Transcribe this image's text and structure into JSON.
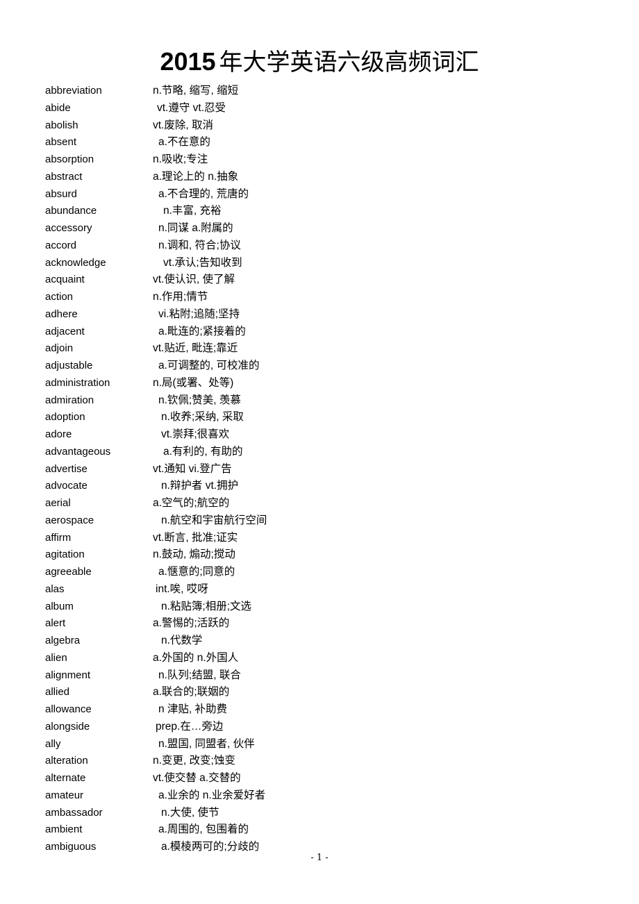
{
  "document": {
    "title_year": "2015",
    "title_rest": "年大学英语六级高频词汇",
    "page_footer": "- 1 -"
  },
  "word_list": {
    "entries": [
      {
        "term": "abbreviation",
        "definition": "n.节略, 缩写, 缩短",
        "indent": 0
      },
      {
        "term": "abide",
        "definition": "vt.遵守 vt.忍受",
        "indent": 6
      },
      {
        "term": "abolish",
        "definition": "vt.废除, 取消",
        "indent": 0
      },
      {
        "term": "absent",
        "definition": "a.不在意的",
        "indent": 8
      },
      {
        "term": "absorption",
        "definition": "n.吸收;专注",
        "indent": 0
      },
      {
        "term": "abstract",
        "definition": "a.理论上的 n.抽象",
        "indent": 0
      },
      {
        "term": "absurd",
        "definition": "a.不合理的, 荒唐的",
        "indent": 8
      },
      {
        "term": "abundance",
        "definition": "n.丰富, 充裕",
        "indent": 15
      },
      {
        "term": "accessory",
        "definition": "n.同谋 a.附属的",
        "indent": 8
      },
      {
        "term": "accord",
        "definition": "n.调和, 符合;协议",
        "indent": 8
      },
      {
        "term": "acknowledge",
        "definition": "vt.承认;告知收到",
        "indent": 15
      },
      {
        "term": "acquaint",
        "definition": "vt.使认识, 使了解",
        "indent": 0
      },
      {
        "term": "action",
        "definition": "n.作用;情节",
        "indent": 0
      },
      {
        "term": "adhere",
        "definition": "vi.粘附;追随;坚持",
        "indent": 8
      },
      {
        "term": "adjacent",
        "definition": "a.毗连的;紧接着的",
        "indent": 8
      },
      {
        "term": "adjoin",
        "definition": "vt.贴近, 毗连;靠近",
        "indent": 0
      },
      {
        "term": "adjustable",
        "definition": "a.可调整的, 可校准的",
        "indent": 8
      },
      {
        "term": "administration",
        "definition": "n.局(或署、处等)",
        "indent": 0
      },
      {
        "term": "admiration",
        "definition": "n.钦佩;赞美, 羡慕",
        "indent": 8
      },
      {
        "term": "adoption",
        "definition": "n.收养;采纳, 采取",
        "indent": 12
      },
      {
        "term": "adore",
        "definition": "vt.崇拜;很喜欢",
        "indent": 12
      },
      {
        "term": "advantageous",
        "definition": "a.有利的, 有助的",
        "indent": 15
      },
      {
        "term": "advertise",
        "definition": "vt.通知 vi.登广告",
        "indent": 0
      },
      {
        "term": "advocate",
        "definition": "n.辩护者 vt.拥护",
        "indent": 12
      },
      {
        "term": "aerial",
        "definition": "a.空气的;航空的",
        "indent": 0
      },
      {
        "term": "aerospace",
        "definition": "n.航空和宇宙航行空间",
        "indent": 12
      },
      {
        "term": "affirm",
        "definition": "vt.断言, 批准;证实",
        "indent": 0
      },
      {
        "term": "agitation",
        "definition": "n.鼓动, 煽动;搅动",
        "indent": 0
      },
      {
        "term": "agreeable",
        "definition": "a.惬意的;同意的",
        "indent": 8
      },
      {
        "term": "alas",
        "definition": "int.唉, 哎呀",
        "indent": 4
      },
      {
        "term": "album",
        "definition": "n.粘贴簿;相册;文选",
        "indent": 12
      },
      {
        "term": "alert",
        "definition": "a.警惕的;活跃的",
        "indent": 0
      },
      {
        "term": "algebra",
        "definition": "n.代数学",
        "indent": 12
      },
      {
        "term": "alien",
        "definition": "a.外国的 n.外国人",
        "indent": 0
      },
      {
        "term": "alignment",
        "definition": "n.队列;结盟, 联合",
        "indent": 8
      },
      {
        "term": "allied",
        "definition": "a.联合的;联姻的",
        "indent": 0
      },
      {
        "term": "allowance",
        "definition": "n 津贴, 补助费",
        "indent": 8
      },
      {
        "term": "alongside",
        "definition": "prep.在…旁边",
        "indent": 4
      },
      {
        "term": "ally",
        "definition": "n.盟国, 同盟者, 伙伴",
        "indent": 8
      },
      {
        "term": "alteration",
        "definition": "n.变更, 改变;蚀变",
        "indent": 0
      },
      {
        "term": "alternate",
        "definition": "vt.使交替 a.交替的",
        "indent": 0
      },
      {
        "term": "amateur",
        "definition": "a.业余的 n.业余爱好者",
        "indent": 8
      },
      {
        "term": "ambassador",
        "definition": "n.大使, 使节",
        "indent": 12
      },
      {
        "term": "ambient",
        "definition": "a.周围的, 包围着的",
        "indent": 8
      },
      {
        "term": "ambiguous",
        "definition": "a.模棱两可的;分歧的",
        "indent": 12
      }
    ]
  }
}
